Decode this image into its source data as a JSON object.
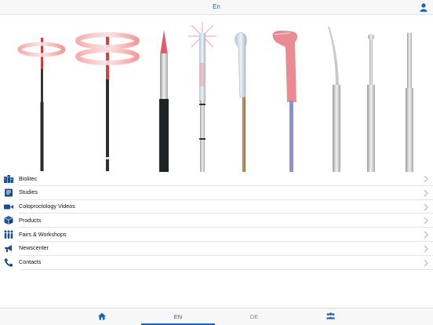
{
  "header": {
    "language_label": "En",
    "user_icon": "user-icon"
  },
  "hero": {
    "image": "probe-tips-illustration"
  },
  "menu": {
    "items": [
      {
        "label": "Biolitec",
        "icon": "company-icon"
      },
      {
        "label": "Studies",
        "icon": "book-icon"
      },
      {
        "label": "Coloproctology Videos",
        "icon": "video-camera-icon"
      },
      {
        "label": "Products",
        "icon": "box-icon"
      },
      {
        "label": "Fairs & Workshops",
        "icon": "people-icon"
      },
      {
        "label": "Newscenter",
        "icon": "megaphone-icon"
      },
      {
        "label": "Contacts",
        "icon": "phone-icon"
      }
    ]
  },
  "tabs": [
    {
      "label": "",
      "icon": "home-icon"
    },
    {
      "label": "EN",
      "active": true
    },
    {
      "label": "DE"
    },
    {
      "label": "",
      "icon": "group-icon"
    }
  ],
  "colors": {
    "accent": "#1f64b0",
    "icon_blue": "#1d4f8f"
  }
}
